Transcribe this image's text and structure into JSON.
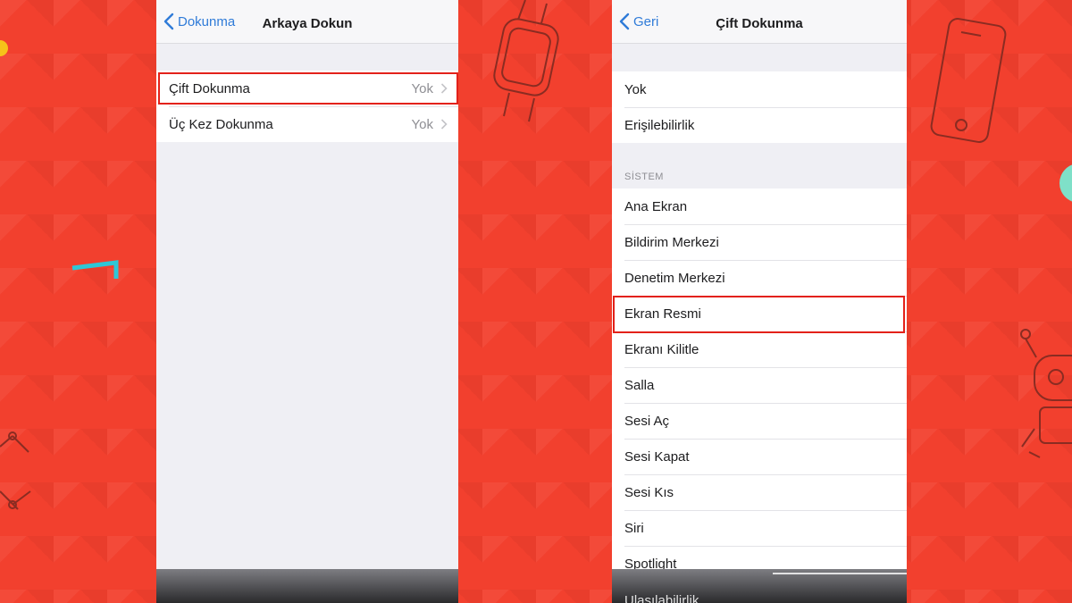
{
  "left_screen": {
    "back_label": "Dokunma",
    "title": "Arkaya Dokun",
    "rows": [
      {
        "label": "Çift Dokunma",
        "value": "Yok"
      },
      {
        "label": "Üç Kez Dokunma",
        "value": "Yok"
      }
    ]
  },
  "right_screen": {
    "back_label": "Geri",
    "title": "Çift Dokunma",
    "top_rows": [
      {
        "label": "Yok"
      },
      {
        "label": "Erişilebilirlik"
      }
    ],
    "section_header": "SİSTEM",
    "system_rows": [
      {
        "label": "Ana Ekran"
      },
      {
        "label": "Bildirim Merkezi"
      },
      {
        "label": "Denetim Merkezi"
      },
      {
        "label": "Ekran Resmi"
      },
      {
        "label": "Ekranı Kilitle"
      },
      {
        "label": "Salla"
      },
      {
        "label": "Sesi Aç"
      },
      {
        "label": "Sesi Kapat"
      },
      {
        "label": "Sesi Kıs"
      },
      {
        "label": "Siri"
      },
      {
        "label": "Spotlight"
      }
    ],
    "cut_row": "Ulaşılabilirlik"
  },
  "colors": {
    "background": "#f2402e",
    "accent_blue": "#2f7bd8",
    "highlight_red": "#e3211a"
  }
}
